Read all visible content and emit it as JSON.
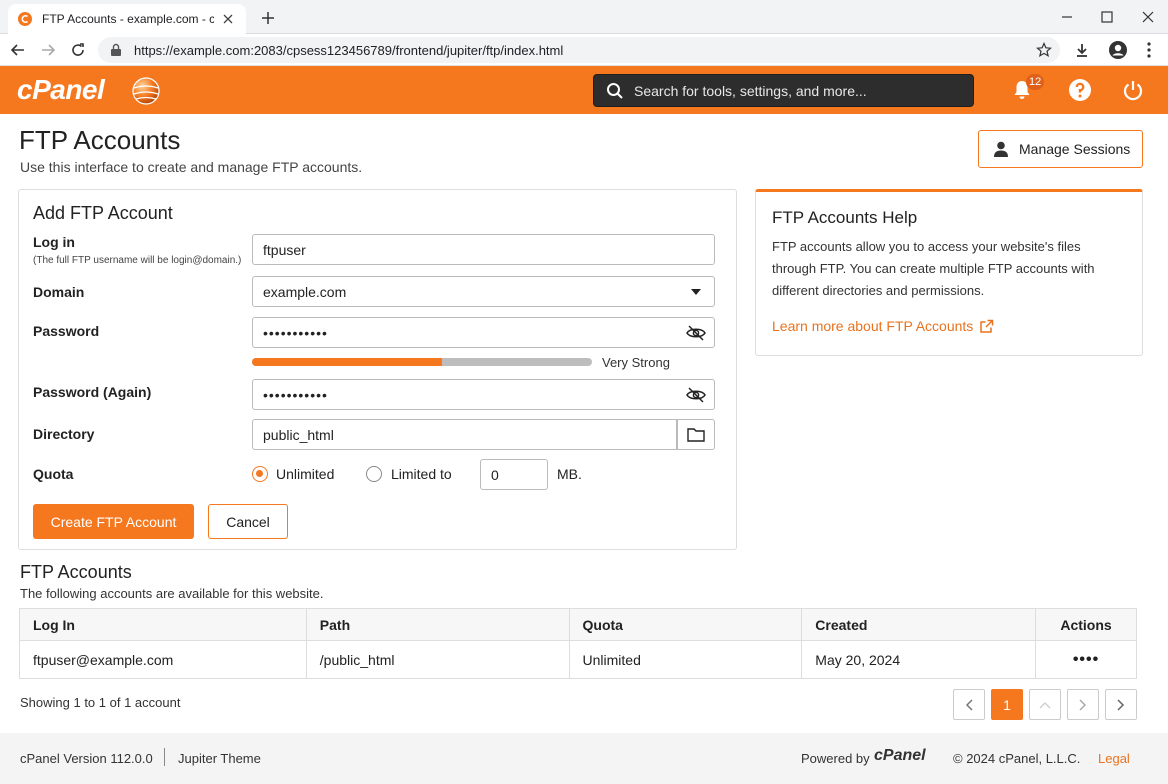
{
  "browser": {
    "tab_title": "FTP Accounts - example.com - cPanel",
    "url": "https://example.com:2083/cpsess123456789/frontend/jupiter/ftp/index.html"
  },
  "header": {
    "logo": "cPanel",
    "search_placeholder": "Search for tools, settings, and more...",
    "notification_count": "12",
    "brand_color": "#f5781f"
  },
  "page": {
    "title": "FTP Accounts",
    "subtitle": "Use this interface to create and manage FTP accounts.",
    "manage_sessions": "Manage Sessions"
  },
  "form": {
    "title": "Add FTP Account",
    "login_label": "Log in",
    "login_hint": "(The full FTP username will be login@domain.)",
    "login_value": "ftpuser",
    "domain_label": "Domain",
    "domain_value": "example.com",
    "password_label": "Password",
    "password_mask": "•••••••••••",
    "strength_fraction": 0.56,
    "strength_label": "Very Strong",
    "password_again_label": "Password (Again)",
    "password_again_mask": "•••••••••••",
    "directory_label": "Directory",
    "directory_value": "public_html",
    "quota_label": "Quota",
    "quota_unlimited": "Unlimited",
    "quota_limited": "Limited to",
    "quota_value": "0",
    "quota_unit": "MB.",
    "quota_selected": "unlimited",
    "create_button": "Create FTP Account",
    "cancel_button": "Cancel"
  },
  "help": {
    "title": "FTP Accounts Help",
    "body": "FTP accounts allow you to access your website's files through FTP. You can create multiple FTP accounts with different directories and permissions.",
    "link": "Learn more about FTP Accounts"
  },
  "accounts": {
    "title": "FTP Accounts",
    "subtitle": "The following accounts are available for this website.",
    "columns": [
      "Log In",
      "Path",
      "Quota",
      "Created",
      "Actions"
    ],
    "rows": [
      {
        "login": "ftpuser@example.com",
        "path": "/public_html",
        "quota": "Unlimited",
        "created": "May 20, 2024",
        "actions": "••••"
      }
    ],
    "showing": "Showing 1 to 1 of 1 account",
    "current_page": "1"
  },
  "footer": {
    "version": "cPanel Version 112.0.0",
    "theme": "Jupiter Theme",
    "powered_by": "Powered by",
    "logo": "cPanel",
    "copyright": "© 2024 cPanel, L.L.C.",
    "legal": "Legal"
  }
}
